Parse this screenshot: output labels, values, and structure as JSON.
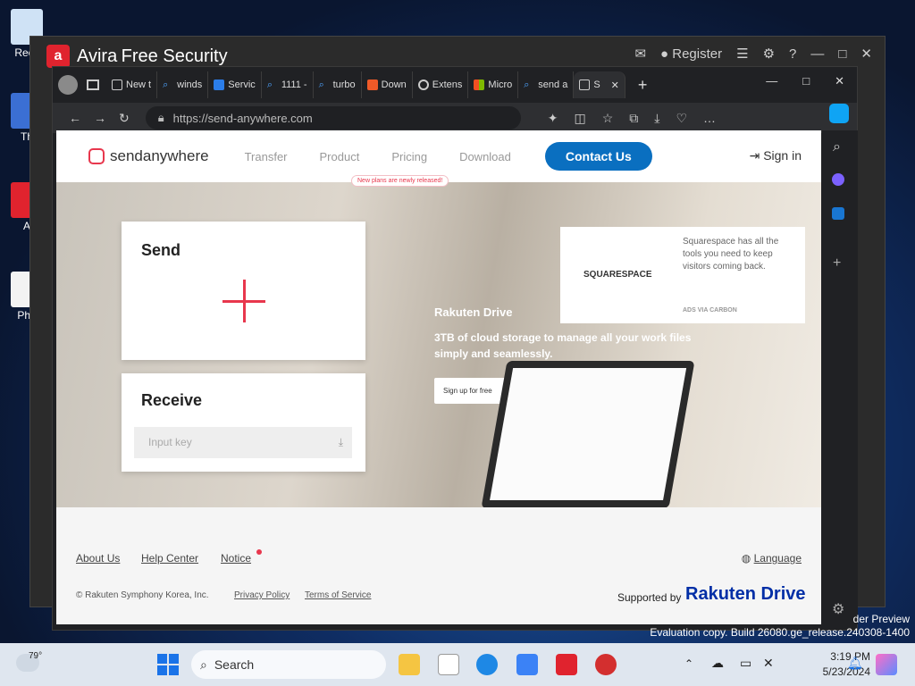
{
  "desktop": {
    "icons": [
      {
        "label": "Recy"
      },
      {
        "label": "Th"
      },
      {
        "label": "A"
      },
      {
        "label": "Pha"
      }
    ],
    "watermark1": "der Preview",
    "watermark2": "Evaluation copy. Build 26080.ge_release.240308-1400"
  },
  "avira": {
    "logo_glyph": "a",
    "brand": "Avira",
    "product": "Free Security",
    "register": "Register"
  },
  "browser": {
    "tabs": [
      {
        "label": "New t"
      },
      {
        "label": "winds"
      },
      {
        "label": "Servic"
      },
      {
        "label": "1111 -"
      },
      {
        "label": "turbo"
      },
      {
        "label": "Down"
      },
      {
        "label": "Extens"
      },
      {
        "label": "Micro"
      },
      {
        "label": "send a"
      },
      {
        "label": "S"
      }
    ],
    "url": "https://send-anywhere.com",
    "add_tab": "+"
  },
  "site": {
    "logo_text": "sendanywhere",
    "nav": [
      "Transfer",
      "Product",
      "Pricing",
      "Download"
    ],
    "pricing_badge": "New plans are newly released!",
    "contact": "Contact Us",
    "signin": "Sign in",
    "send_title": "Send",
    "receive_title": "Receive",
    "input_placeholder": "Input key",
    "ad_logo": "SQUARESPACE",
    "ad_text": "Squarespace has all the tools you need to keep visitors coming back.",
    "ad_by": "ADS VIA CARBON",
    "promo_brand": "Rakuten Drive",
    "promo_line1": "3TB of cloud storage to manage all your work files",
    "promo_line2": "simply and seamlessly.",
    "promo_button": "Sign up for free",
    "footer": {
      "about": "About Us",
      "help": "Help Center",
      "notice": "Notice",
      "language": "Language",
      "copyright": "© Rakuten Symphony Korea, Inc.",
      "privacy": "Privacy Policy",
      "terms": "Terms of Service",
      "supported": "Supported by",
      "partner": "Rakuten Drive"
    }
  },
  "taskbar": {
    "weather": "79°",
    "search": "Search",
    "time": "3:19 PM",
    "date": "5/23/2024"
  }
}
